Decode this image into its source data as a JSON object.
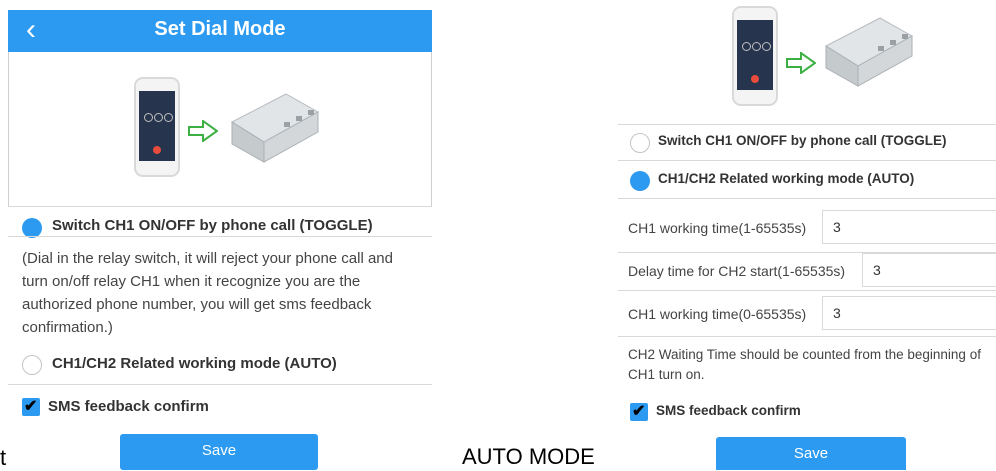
{
  "left": {
    "nav": {
      "title": "Set Dial Mode",
      "back_glyph": "‹"
    },
    "options": [
      {
        "label": "Switch CH1 ON/OFF by phone call (TOGGLE)",
        "selected": true
      },
      {
        "label": "CH1/CH2 Related working mode (AUTO)",
        "selected": false
      }
    ],
    "description": "(Dial in the relay switch, it will reject your phone call and turn on/off relay CH1 when it recognize you are the authorized phone number, you will get sms feedback confirmation.)",
    "sms_label": "SMS feedback confirm",
    "sms_checked": true,
    "save_label": "Save",
    "stray_char": "t"
  },
  "caption": "AUTO MODE",
  "right": {
    "options": [
      {
        "label": "Switch CH1 ON/OFF by phone call (TOGGLE)",
        "selected": false
      },
      {
        "label": "CH1/CH2 Related working mode (AUTO)",
        "selected": true
      }
    ],
    "fields": [
      {
        "label": "CH1 working time(1-65535s)",
        "value": "3"
      },
      {
        "label": "Delay time for CH2 start(1-65535s)",
        "value": "3"
      },
      {
        "label": "CH1 working time(0-65535s)",
        "value": "3"
      }
    ],
    "note": "CH2 Waiting Time should be counted from the beginning of CH1 turn on.",
    "sms_label": "SMS feedback confirm",
    "sms_checked": true,
    "save_label": "Save"
  },
  "colors": {
    "accent": "#2b9af0",
    "device_body": "#cfd3d6",
    "phone_screen": "#26344d",
    "arrow": "#3cb043"
  },
  "icons": [
    "back-chevron-icon",
    "radio-selected-icon",
    "radio-unselected-icon",
    "checkbox-checked-icon",
    "phone-illustration-icon",
    "arrow-right-icon",
    "relay-device-icon"
  ]
}
